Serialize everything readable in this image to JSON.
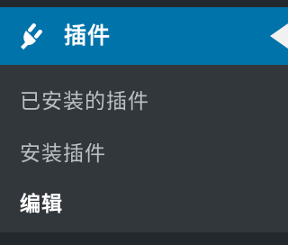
{
  "menu": {
    "header": {
      "icon": "plug-icon",
      "label": "插件",
      "background_color": "#0073aa"
    },
    "submenu": {
      "items": [
        {
          "label": "已安装的插件",
          "active": false
        },
        {
          "label": "安装插件",
          "active": false
        },
        {
          "label": "编辑",
          "active": true
        }
      ],
      "background_color": "#32373c"
    }
  }
}
